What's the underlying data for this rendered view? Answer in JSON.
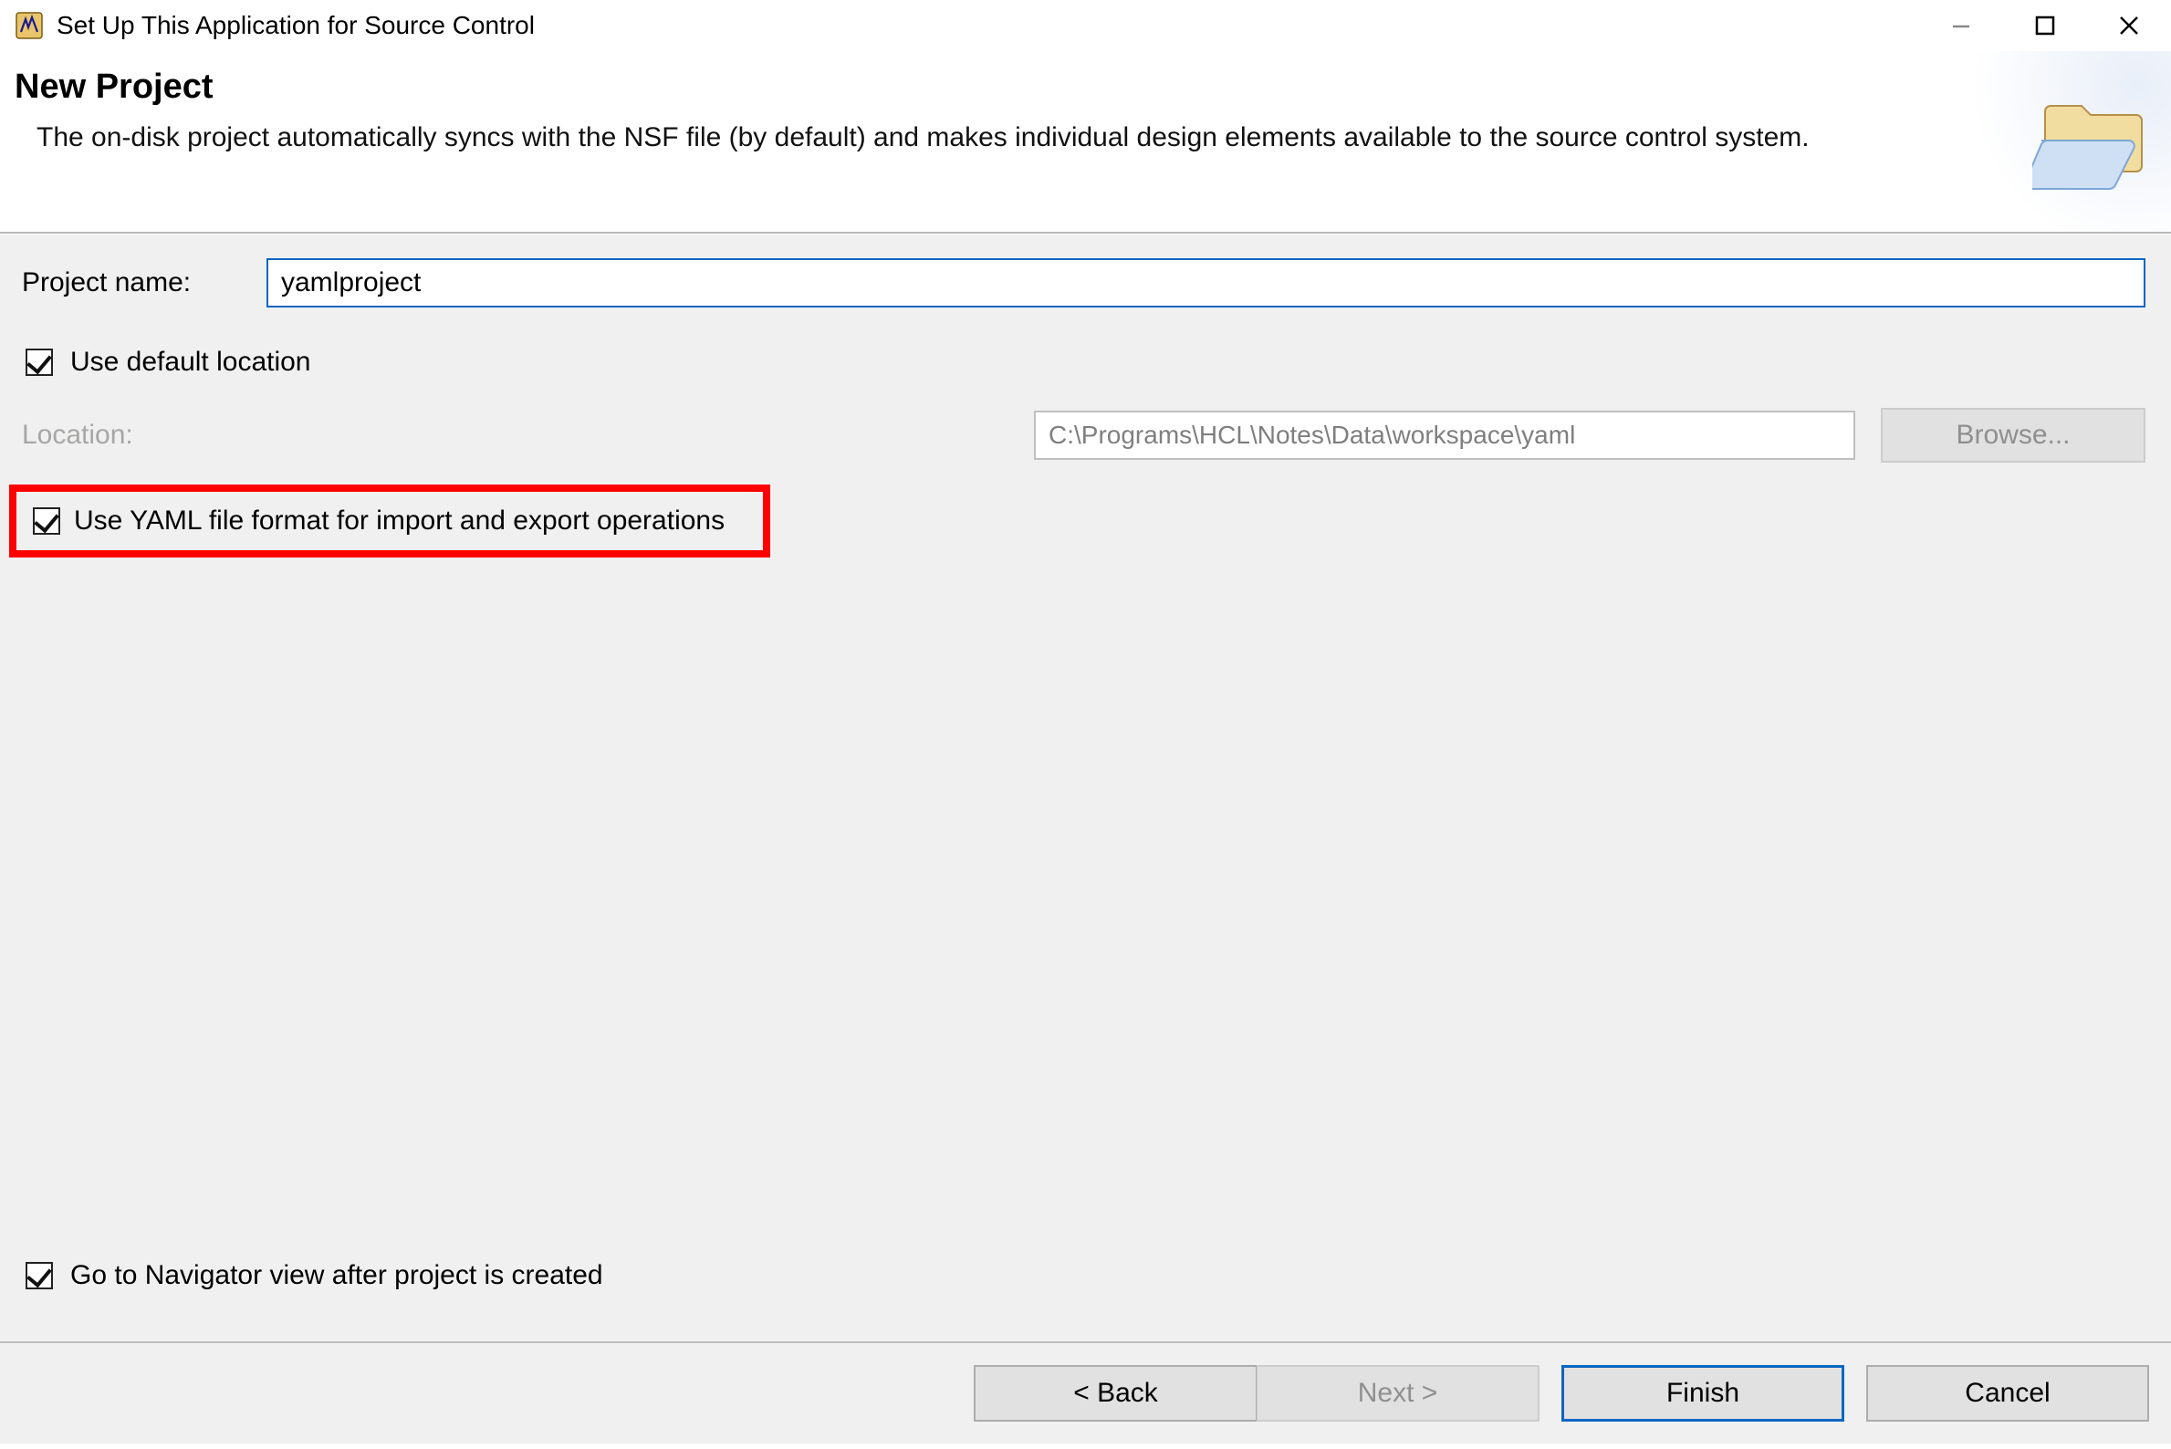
{
  "window": {
    "title": "Set Up This Application for Source Control"
  },
  "banner": {
    "heading": "New Project",
    "description": "The on-disk project automatically syncs with the NSF file (by default) and makes individual design elements available to the source control system."
  },
  "form": {
    "project_name_label": "Project name:",
    "project_name_value": "yamlproject",
    "use_default_location_label": "Use default location",
    "use_default_location_checked": true,
    "location_label": "Location:",
    "location_value": "C:\\Programs\\HCL\\Notes\\Data\\workspace\\yaml",
    "browse_label": "Browse...",
    "use_yaml_label": "Use YAML file format for import and export operations",
    "use_yaml_checked": true,
    "navigator_label": "Go to Navigator view after project is created",
    "navigator_checked": true
  },
  "buttons": {
    "back": "< Back",
    "next": "Next >",
    "finish": "Finish",
    "cancel": "Cancel"
  },
  "icons": {
    "app": "app-icon",
    "folder": "open-folder-icon",
    "minimize": "minimize-icon",
    "maximize": "maximize-icon",
    "close": "close-icon"
  }
}
